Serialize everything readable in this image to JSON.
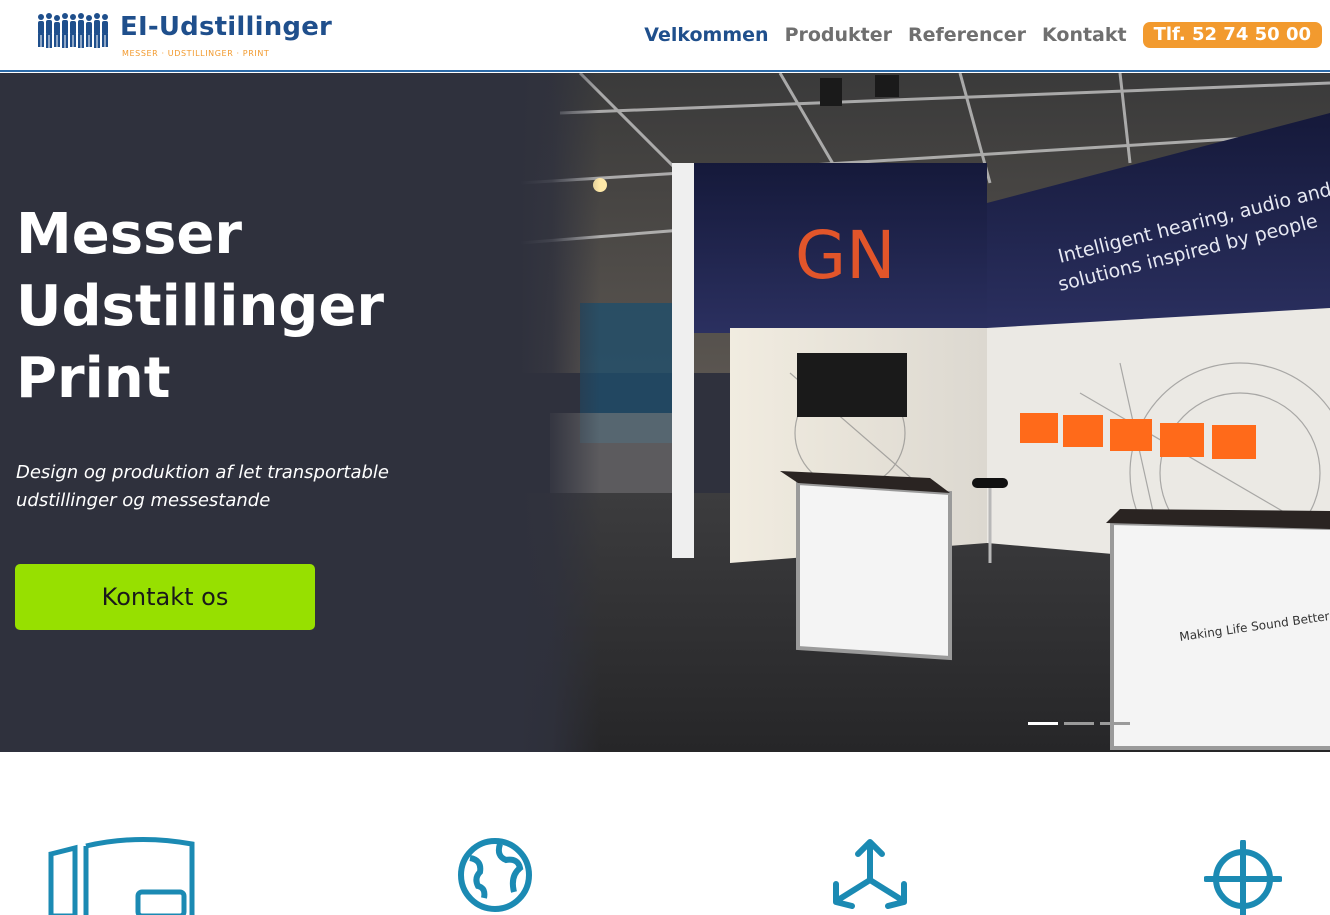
{
  "header": {
    "logo": {
      "title": "EI-Udstillinger",
      "tagline": "MESSER · UDSTILLINGER · PRINT",
      "icon": "people-silhouettes-icon"
    },
    "nav": {
      "items": [
        {
          "label": "Velkommen",
          "active": true
        },
        {
          "label": "Produkter",
          "active": false
        },
        {
          "label": "Referencer",
          "active": false
        },
        {
          "label": "Kontakt",
          "active": false
        }
      ],
      "phone_label": "Tlf. 52 74 50 00"
    }
  },
  "hero": {
    "title_lines": [
      "Messer",
      "Udstillinger",
      "Print"
    ],
    "subtitle": "Design og produktion af let transportable udstillinger og messestande",
    "cta_label": "Kontakt os",
    "slider": {
      "slide_count": 3,
      "active_slide": 1
    },
    "photo": {
      "brand_logo": "GN",
      "banner_text_1": "Intelligent hearing, audio and video",
      "banner_text_2": "solutions inspired by people",
      "counter_text": "Making Life Sound Better"
    }
  },
  "features": {
    "icons": [
      "exhibition-stand-icon",
      "globe-icon",
      "three-arrows-icon",
      "target-crosshair-icon"
    ]
  },
  "colors": {
    "brand_blue": "#1f4f8c",
    "accent_orange": "#f29a2e",
    "cta_green": "#97e000",
    "hero_bg": "#2f313d",
    "icon_teal": "#1b8ab3"
  }
}
